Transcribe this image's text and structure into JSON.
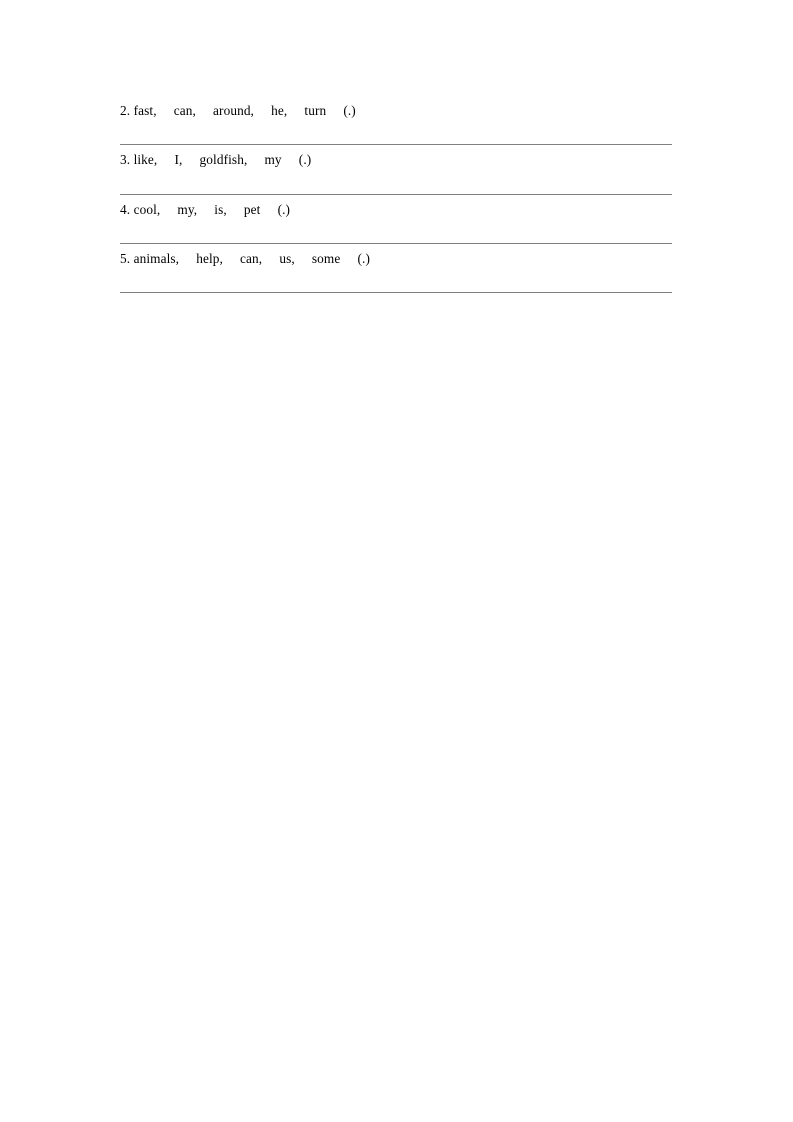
{
  "document": {
    "page_background": "#ffffff",
    "text_color": "#000000",
    "rule_color": "#808080"
  },
  "exercises": [
    {
      "number": "2.",
      "words_text": "2. fast,     can,     around,     he,     turn     (.)",
      "words": [
        "fast,",
        "can,",
        "around,",
        "he,",
        "turn",
        "(.)"
      ]
    },
    {
      "number": "3.",
      "words_text": "3. like,     I,     goldfish,     my     (.)",
      "words": [
        "like,",
        "I,",
        "goldfish,",
        "my",
        "(.)"
      ]
    },
    {
      "number": "4.",
      "words_text": "4. cool,     my,     is,     pet     (.)",
      "words": [
        "cool,",
        "my,",
        "is,",
        "pet",
        "(.)"
      ]
    },
    {
      "number": "5.",
      "words_text": "5. animals,     help,     can,     us,     some     (.)",
      "words": [
        "animals,",
        "help,",
        "can,",
        "us,",
        "some",
        "(.)"
      ]
    }
  ]
}
